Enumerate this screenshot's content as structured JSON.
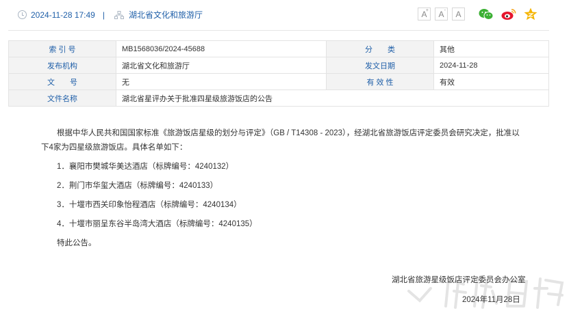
{
  "header": {
    "datetime": "2024-11-28 17:49",
    "separator": "|",
    "source": "湖北省文化和旅游厅",
    "font_large": "A",
    "font_medium": "A",
    "font_small": "A",
    "share_icons": [
      "wechat-icon",
      "weibo-icon",
      "qzone-icon"
    ],
    "colors": {
      "link": "#1f5fa8",
      "wechat": "#3cb034",
      "weibo": "#e6162d",
      "qzone": "#f5b400"
    }
  },
  "info_table": {
    "index_label": "索 引 号",
    "index_value": "MB1568036/2024-45688",
    "category_label": "分　　类",
    "category_value": "其他",
    "publisher_label": "发布机构",
    "publisher_value": "湖北省文化和旅游厅",
    "date_label": "发文日期",
    "date_value": "2024-11-28",
    "docno_label": "文　　号",
    "docno_value": "无",
    "validity_label": "有 效 性",
    "validity_value": "有效",
    "title_label": "文件名称",
    "title_value": "湖北省星评办关于批准四星级旅游饭店的公告"
  },
  "content": {
    "paragraph": "根据中华人民共和国国家标准《旅游饭店星级的划分与评定》（GB / T14308 - 2023），经湖北省旅游饭店评定委员会研究决定，批准以下4家为四星级旅游饭店。具体名单如下：",
    "items": [
      "1．襄阳市樊城华美达酒店（标牌编号：4240132）",
      "2．荆门市华玺大酒店（标牌编号：4240133）",
      "3．十堰市西关印象怡程酒店（标牌编号：4240134）",
      "4．十堰市丽呈东谷半岛湾大酒店（标牌编号：4240135）"
    ],
    "closing": "特此公告。",
    "signature": "湖北省旅游星级饭店评定委员会办公室",
    "sign_date": "2024年11月28日"
  },
  "watermark": "湖北日报"
}
